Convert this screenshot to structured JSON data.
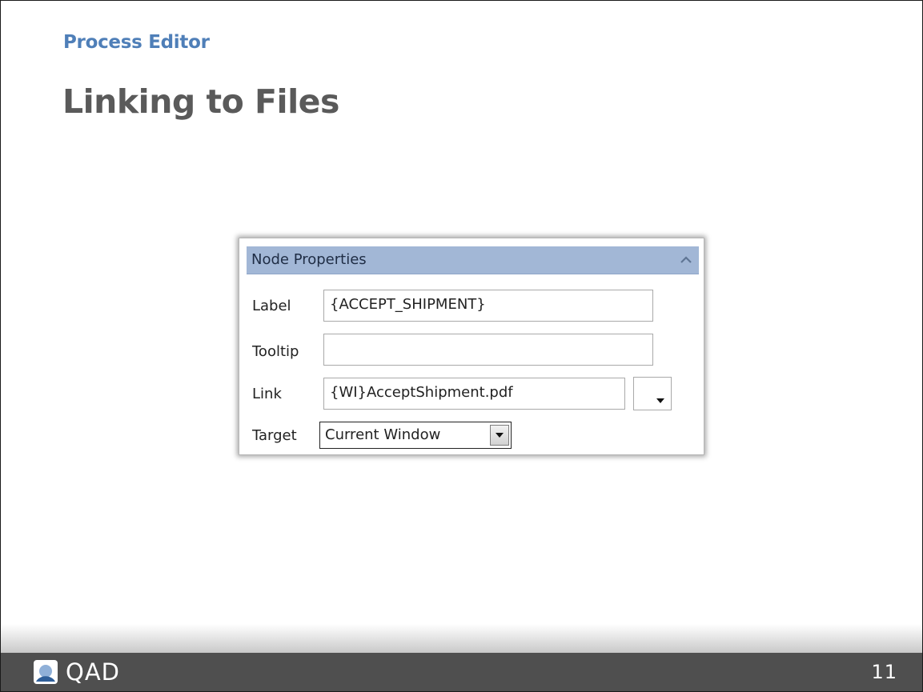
{
  "header": {
    "kicker": "Process Editor",
    "title": "Linking to Files"
  },
  "panel": {
    "title": "Node Properties",
    "collapse_icon": "chevron-up-icon",
    "fields": {
      "label": {
        "label": "Label",
        "value": "{ACCEPT_SHIPMENT}"
      },
      "tooltip": {
        "label": "Tooltip",
        "value": ""
      },
      "link": {
        "label": "Link",
        "value": "{WI}AcceptShipment.pdf",
        "dropdown_icon": "caret-down-icon"
      },
      "target": {
        "label": "Target",
        "value": "Current Window",
        "dropdown_icon": "caret-down-icon"
      }
    },
    "header_color": "#a2b7d6"
  },
  "footer": {
    "logo_text": "QAD",
    "logo_icon": "qad-logo-icon",
    "page_number": "11",
    "bar_color": "#4f4f4f"
  },
  "colors": {
    "kicker": "#4f7fb8",
    "title": "#5a5a5a"
  }
}
